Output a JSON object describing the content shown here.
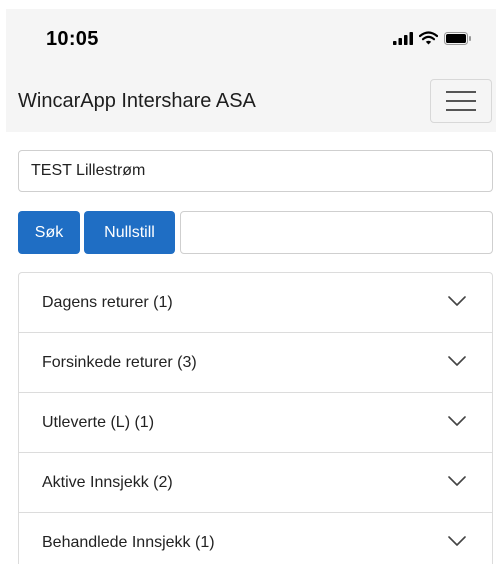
{
  "status_bar": {
    "time": "10:05",
    "icons": [
      "cellular-signal-icon",
      "wifi-icon",
      "battery-icon"
    ]
  },
  "navbar": {
    "brand": "WincarApp Intershare ASA",
    "menu_icon": "hamburger-menu-icon"
  },
  "form": {
    "location_value": "TEST Lillestrøm",
    "search_label": "Søk",
    "reset_label": "Nullstill",
    "search_value": ""
  },
  "accordion": {
    "items": [
      {
        "label": "Dagens returer (1)"
      },
      {
        "label": "Forsinkede returer (3)"
      },
      {
        "label": "Utleverte (L) (1)"
      },
      {
        "label": "Aktive Innsjekk (2)"
      },
      {
        "label": "Behandlede Innsjekk (1)"
      }
    ]
  },
  "colors": {
    "primary_button": "#1f6ec4",
    "navbar_background": "#f5f5f5"
  }
}
